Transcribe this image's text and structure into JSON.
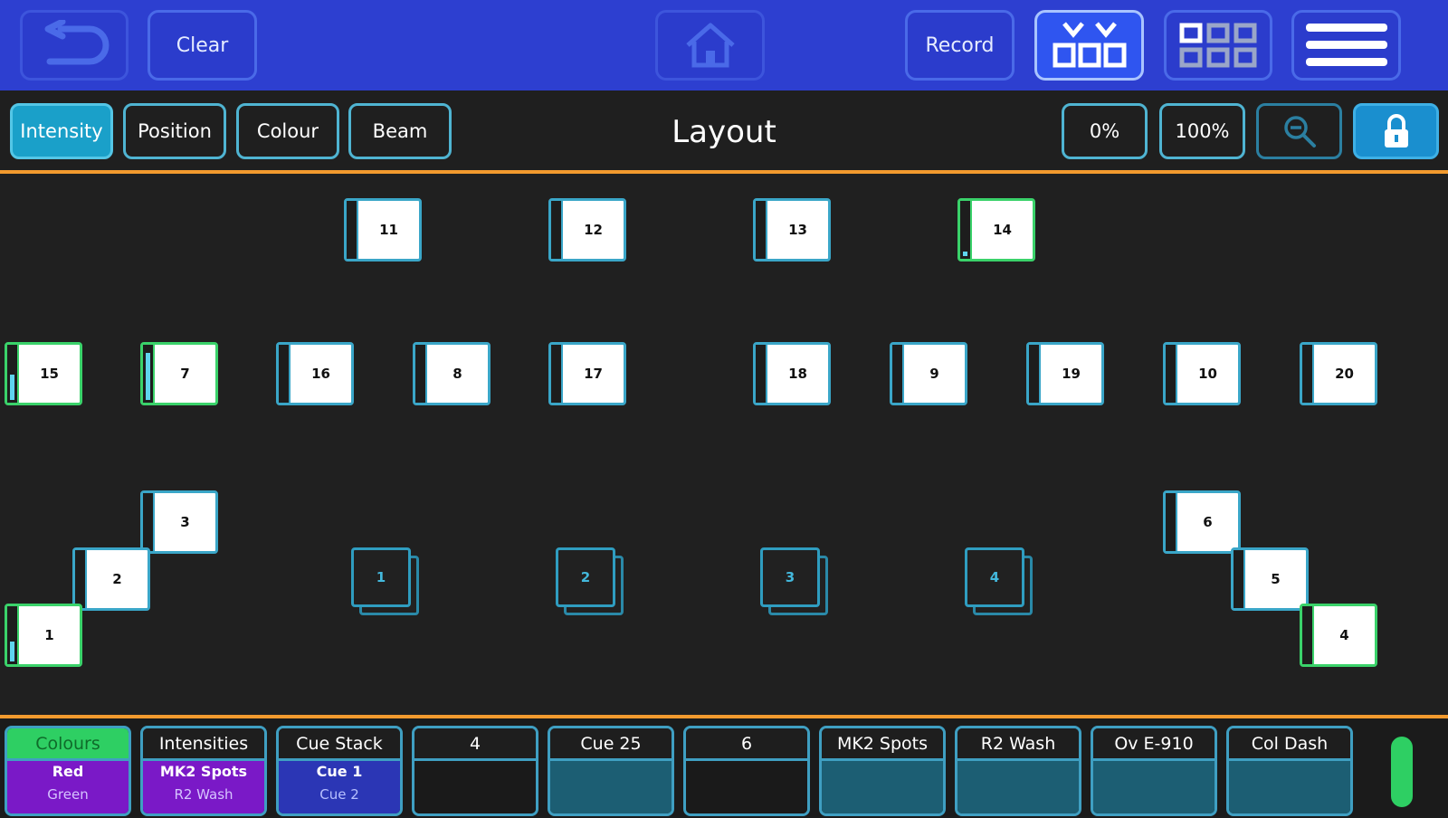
{
  "toolbar": {
    "clear_label": "Clear",
    "record_label": "Record"
  },
  "attribute_tabs": [
    "Intensity",
    "Position",
    "Colour",
    "Beam"
  ],
  "view": {
    "title": "Layout",
    "zero_label": "0%",
    "full_label": "100%"
  },
  "fixtures": {
    "f11": "11",
    "f12": "12",
    "f13": "13",
    "f14": "14",
    "f15": "15",
    "f7": "7",
    "f16": "16",
    "f8": "8",
    "f17": "17",
    "f18": "18",
    "f9": "9",
    "f19": "19",
    "f10": "10",
    "f20": "20",
    "f3": "3",
    "f2": "2",
    "f1": "1",
    "f6": "6",
    "f5": "5",
    "f4": "4"
  },
  "groups": [
    "1",
    "2",
    "3",
    "4"
  ],
  "playbacks": [
    {
      "header": "Colours",
      "line1": "Red",
      "line2": "Green"
    },
    {
      "header": "Intensities",
      "line1": "MK2 Spots",
      "line2": "R2 Wash"
    },
    {
      "header": "Cue Stack",
      "line1": "Cue 1",
      "line2": "Cue 2"
    },
    {
      "header": "4",
      "line1": "",
      "line2": ""
    },
    {
      "header": "Cue 25",
      "line1": "",
      "line2": ""
    },
    {
      "header": "6",
      "line1": "",
      "line2": ""
    },
    {
      "header": "MK2 Spots",
      "line1": "",
      "line2": ""
    },
    {
      "header": "R2 Wash",
      "line1": "",
      "line2": ""
    },
    {
      "header": "Ov E-910",
      "line1": "",
      "line2": ""
    },
    {
      "header": "Col Dash",
      "line1": "",
      "line2": ""
    }
  ],
  "colors": {
    "topbar": "#2d3fd0",
    "accent_orange": "#f29a2e",
    "accent_cyan": "#4fb4d2",
    "selected_green": "#3ad26a",
    "playback_purple": "#7a19c7",
    "playback_blue": "#2b36b5"
  },
  "icons": {
    "undo": "undo-arrow-icon",
    "home": "home-icon",
    "fixture_view": "fixture-view-icon",
    "grid_view": "grid-view-icon",
    "menu": "hamburger-menu-icon",
    "zoom": "zoom-out-icon",
    "lock": "lock-icon"
  }
}
